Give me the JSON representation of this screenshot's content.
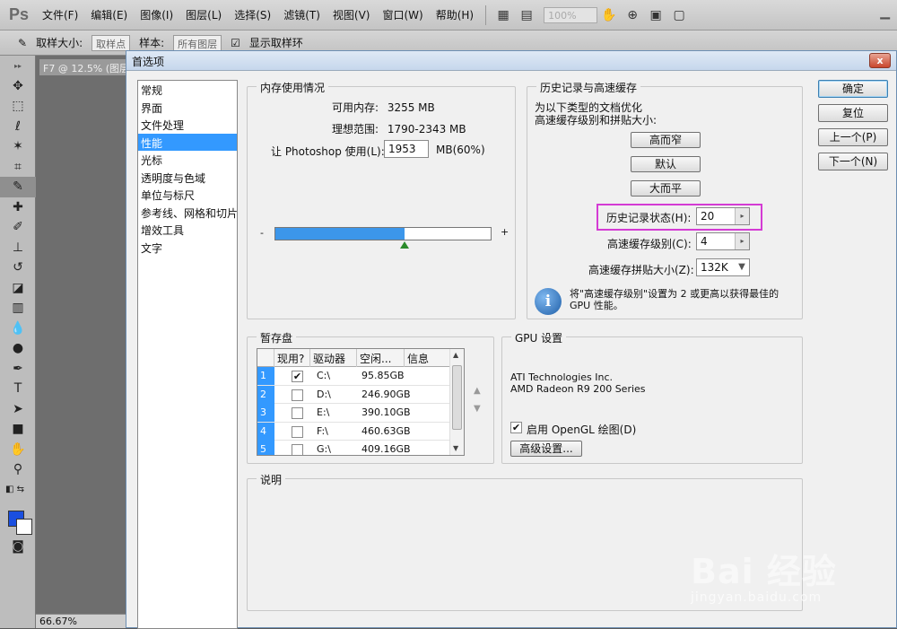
{
  "app": {
    "logo": "Ps",
    "menu": [
      "文件(F)",
      "编辑(E)",
      "图像(I)",
      "图层(L)",
      "选择(S)",
      "滤镜(T)",
      "视图(V)",
      "窗口(W)",
      "帮助(H)"
    ],
    "zoom": "100%"
  },
  "options_bar": {
    "sample_size_label": "取样大小:",
    "sample_size_value": "取样点",
    "sample_label": "样本:",
    "sample_value": "所有图层",
    "show_ring_label": "显示取样环"
  },
  "document": {
    "tab_title": "F7 @ 12.5% (图层",
    "zoom_status": "66.67%"
  },
  "dialog": {
    "title": "首选项",
    "close": "x",
    "nav": [
      "常规",
      "界面",
      "文件处理",
      "性能",
      "光标",
      "透明度与色域",
      "单位与标尺",
      "参考线、网格和切片",
      "增效工具",
      "文字"
    ],
    "nav_selected_index": 3,
    "buttons": {
      "ok": "确定",
      "reset": "复位",
      "prev": "上一个(P)",
      "next": "下一个(N)"
    },
    "memory": {
      "legend": "内存使用情况",
      "available_label": "可用内存:",
      "available_value": "3255 MB",
      "ideal_label": "理想范围:",
      "ideal_value": "1790-2343 MB",
      "let_label": "让 Photoshop 使用(L):",
      "let_value": "1953",
      "let_unit": "MB(60%)",
      "minus": "-",
      "plus": "+",
      "percent": 60
    },
    "history": {
      "legend": "历史记录与高速缓存",
      "desc1": "为以下类型的文档优化",
      "desc2": "高速缓存级别和拼贴大小:",
      "btn_tall": "高而窄",
      "btn_default": "默认",
      "btn_wide": "大而平",
      "states_label": "历史记录状态(H):",
      "states_value": "20",
      "levels_label": "高速缓存级别(C):",
      "levels_value": "4",
      "tile_label": "高速缓存拼贴大小(Z):",
      "tile_value": "132K",
      "info_line1": "将\"高速缓存级别\"设置为 2 或更高以获得最佳的",
      "info_line2": "GPU 性能。"
    },
    "scratch": {
      "legend": "暂存盘",
      "headers": [
        "现用?",
        "驱动器",
        "空闲...",
        "信息"
      ],
      "rows": [
        {
          "num": "1",
          "checked": true,
          "drive": "C:\\",
          "free": "95.85GB"
        },
        {
          "num": "2",
          "checked": false,
          "drive": "D:\\",
          "free": "246.90GB"
        },
        {
          "num": "3",
          "checked": false,
          "drive": "E:\\",
          "free": "390.10GB"
        },
        {
          "num": "4",
          "checked": false,
          "drive": "F:\\",
          "free": "460.63GB"
        },
        {
          "num": "5",
          "checked": false,
          "drive": "G:\\",
          "free": "409.16GB"
        }
      ]
    },
    "gpu": {
      "legend": "GPU 设置",
      "vendor": "ATI Technologies Inc.",
      "model": "AMD Radeon R9 200 Series",
      "opengl_label": "启用 OpenGL 绘图(D)",
      "advanced_btn": "高级设置..."
    },
    "description": {
      "legend": "说明"
    }
  },
  "watermark": {
    "text": "Bai 经验",
    "url": "jingyan.baidu.com"
  }
}
